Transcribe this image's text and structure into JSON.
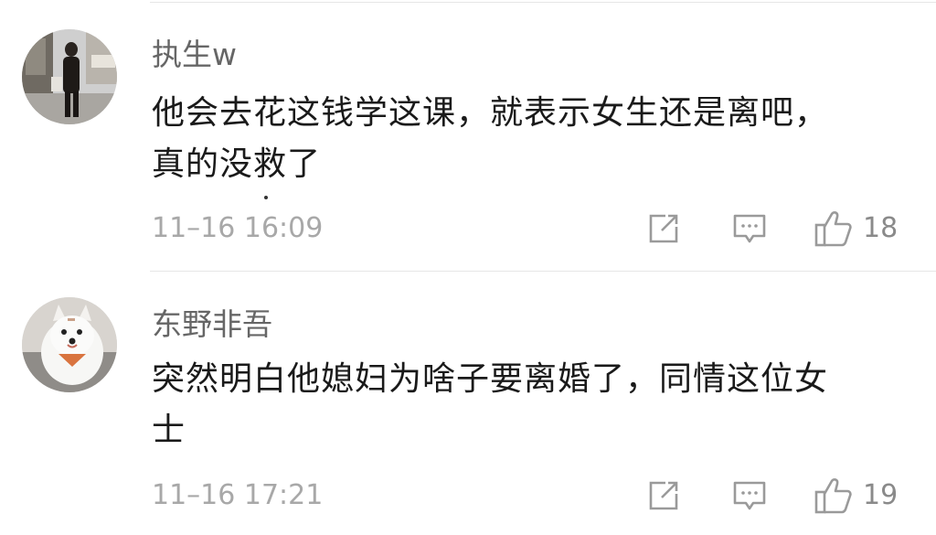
{
  "comments": [
    {
      "username": "执生w",
      "text_lines": [
        "他会去花这钱学这课，就表示女生还是离吧，",
        "真的没救了"
      ],
      "time": "11–16 16:09",
      "likes": "18",
      "avatar": "person-photo-avatar",
      "actions": [
        "share-icon",
        "comment-icon",
        "thumbs-up-icon"
      ]
    },
    {
      "username": "东野非吾",
      "text_lines": [
        "突然明白他媳妇为啥子要离婚了，同情这位女",
        "士"
      ],
      "time": "11–16 17:21",
      "likes": "19",
      "avatar": "white-dog-avatar",
      "actions": [
        "share-icon",
        "comment-icon",
        "thumbs-up-icon"
      ]
    }
  ],
  "colors": {
    "username": "#666666",
    "text": "#1a1a1a",
    "meta": "#a8a8a8",
    "icon": "#9a9a9a",
    "divider": "#e6e6e6"
  }
}
